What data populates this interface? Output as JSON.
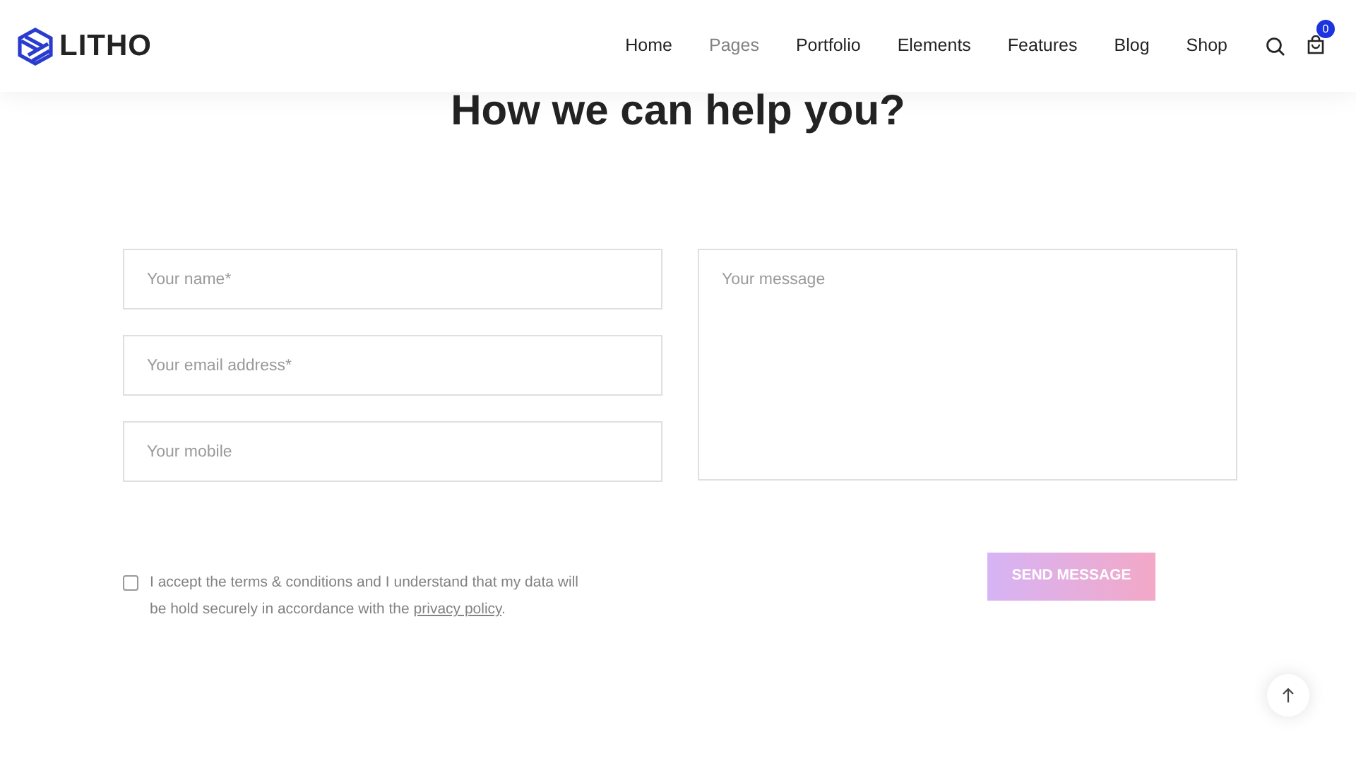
{
  "brand": {
    "name": "LITHO"
  },
  "nav": [
    {
      "label": "Home",
      "selected": false
    },
    {
      "label": "Pages",
      "selected": true
    },
    {
      "label": "Portfolio",
      "selected": false
    },
    {
      "label": "Elements",
      "selected": false
    },
    {
      "label": "Features",
      "selected": false
    },
    {
      "label": "Blog",
      "selected": false
    },
    {
      "label": "Shop",
      "selected": false
    }
  ],
  "cart": {
    "count": "0"
  },
  "heading": "How we can help you?",
  "fields": [
    {
      "placeholder": "Your name*"
    },
    {
      "placeholder": "Your email address*"
    },
    {
      "placeholder": "Your mobile"
    }
  ],
  "message": {
    "placeholder": "Your message"
  },
  "consent": {
    "checked": false,
    "text": "I accept the terms & conditions and I understand that my data will be hold securely in accordance with the ",
    "link": "privacy policy",
    "after": "."
  },
  "submit": {
    "label": "SEND MESSAGE"
  }
}
